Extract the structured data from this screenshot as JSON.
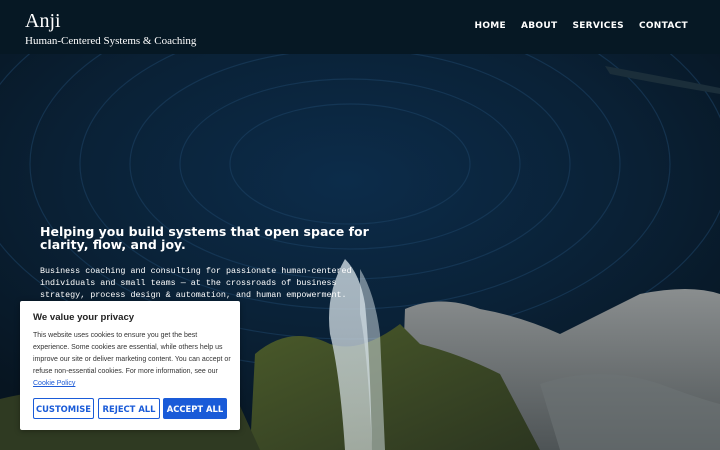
{
  "brand": {
    "name": "Anji",
    "tagline": "Human-Centered Systems & Coaching"
  },
  "nav": {
    "items": [
      {
        "label": "HOME"
      },
      {
        "label": "ABOUT"
      },
      {
        "label": "SERVICES"
      },
      {
        "label": "CONTACT"
      }
    ]
  },
  "hero": {
    "title": "Helping you build systems that open space for clarity, flow, and joy.",
    "description": "Business coaching and consulting for passionate human-centered individuals and small teams — at the crossroads of business strategy, process design & automation, and human empowerment."
  },
  "cookie": {
    "title": "We value your privacy",
    "body": "This website uses cookies to ensure you get the best experience. Some cookies are essential, while others help us improve our site or deliver marketing content. You can accept or refuse non-essential cookies. For more information, see our",
    "link_label": "Cookie Policy",
    "customise_label": "CUSTOMISE",
    "reject_label": "REJECT ALL",
    "accept_label": "ACCEPT ALL"
  },
  "colors": {
    "header_bg": "#061824",
    "accent": "#1a5bd8"
  }
}
